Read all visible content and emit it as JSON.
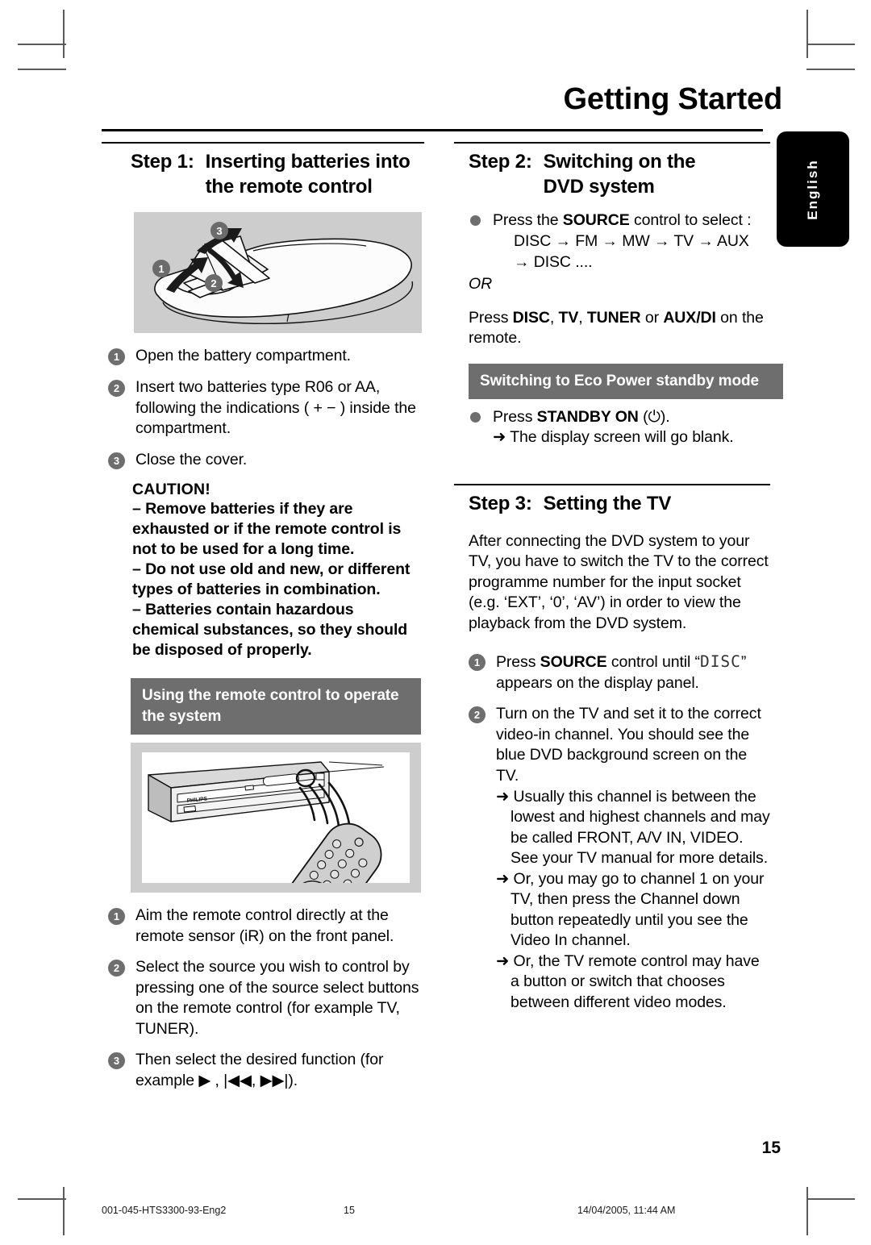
{
  "header": {
    "title": "Getting Started",
    "language_tab": "English",
    "page_number": "15"
  },
  "left_column": {
    "step1": {
      "label": "Step 1:",
      "title_line1": "Inserting batteries into",
      "title_line2": "the remote control"
    },
    "battery_figure": {
      "caption": "remote-control-battery-compartment-illustration",
      "callouts": [
        "1",
        "2",
        "3"
      ],
      "polarity": [
        "+",
        "+"
      ]
    },
    "steps": [
      {
        "num": "1",
        "text": "Open the battery compartment."
      },
      {
        "num": "2",
        "text": "Insert two batteries type R06 or AA, following the indications ( + − ) inside the compartment."
      },
      {
        "num": "3",
        "text": "Close the cover."
      }
    ],
    "caution": {
      "title": "CAUTION!",
      "lines": [
        "– Remove batteries if they are exhausted or if the remote control is not to be used for a long time.",
        "– Do not use old and new, or different types of batteries in combination.",
        "– Batteries contain hazardous chemical substances, so they should be disposed of properly."
      ]
    },
    "subhead_remote": "Using the remote control to operate the system",
    "player_figure": {
      "caption": "dvd-player-and-remote-ir-illustration",
      "brand": "PHILIPS"
    },
    "remote_steps": [
      {
        "num": "1",
        "text": "Aim the remote control directly at the remote sensor (iR) on the front panel."
      },
      {
        "num": "2",
        "text": "Select the source you wish to control by pressing one of the source select buttons on the remote control (for example TV, TUNER)."
      },
      {
        "num": "3",
        "text": "Then select the desired function (for example ▶ , |◀◀, ▶▶|)."
      }
    ]
  },
  "right_column": {
    "step2": {
      "label": "Step 2:",
      "title_line1": "Switching on the",
      "title_line2": "DVD system",
      "bullet_prefix": "Press the ",
      "bullet_bold": "SOURCE",
      "bullet_suffix": " control to select :",
      "sequence_line1": "DISC  → FM → MW → TV → AUX",
      "sequence_line2": "→ DISC ....",
      "or": "OR",
      "alt_prefix": "Press ",
      "alt_bold1": "DISC",
      "alt_sep1": ", ",
      "alt_bold2": "TV",
      "alt_sep2": ", ",
      "alt_bold3": "TUNER",
      "alt_mid": " or ",
      "alt_bold4": "AUX/DI",
      "alt_suffix": " on the remote."
    },
    "eco": {
      "heading": "Switching to Eco Power standby mode",
      "bullet_prefix": "Press ",
      "bullet_bold": "STANDBY ON",
      "bullet_suffix": " (⏻).",
      "result": "➜ The display screen will go blank."
    },
    "step3": {
      "label": "Step 3:",
      "title": "Setting the TV",
      "paragraph": "After connecting the DVD system to your TV, you have to switch the TV to the correct programme number for the input socket (e.g. ‘EXT’, ‘0’, ‘AV’) in order to view the playback from the DVD system.",
      "steps": [
        {
          "num": "1",
          "pre": "Press ",
          "bold": "SOURCE",
          "mid": " control until “",
          "lcd": "DISC",
          "post": "” appears on the display panel.",
          "notes": []
        },
        {
          "num": "2",
          "pre": "",
          "bold": "",
          "mid": "",
          "lcd": "",
          "post": "Turn on the TV and set it to the correct video-in channel. You should see the blue DVD background screen on the TV.",
          "notes": [
            "➜ Usually this channel is between the lowest and highest channels and may be called FRONT, A/V IN, VIDEO. See your TV manual for more details.",
            "➜ Or, you may go to channel 1 on your TV, then press the Channel down button repeatedly until you see the Video In channel.",
            "➜ Or, the TV remote control may have a button or switch that chooses between different video modes."
          ]
        }
      ]
    }
  },
  "footer": {
    "file": "001-045-HTS3300-93-Eng2",
    "page": "15",
    "date": "14/04/2005, 11:44 AM"
  },
  "colors": {
    "gray_band": "#6e6e6e",
    "figure_bg": "#cdcdcd",
    "tab_bg": "#000000"
  }
}
